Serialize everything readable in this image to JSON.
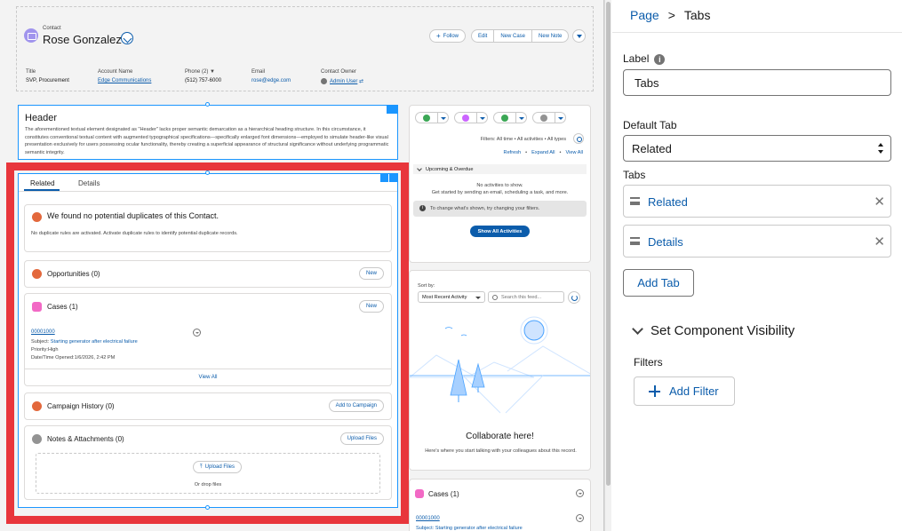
{
  "record": {
    "type": "Contact",
    "name": "Rose Gonzalez",
    "actions": {
      "follow": "Follow",
      "edit": "Edit",
      "new_case": "New Case",
      "new_note": "New Note"
    },
    "highlights": [
      {
        "label": "Title",
        "value": "SVP, Procurement"
      },
      {
        "label": "Account Name",
        "value": "Edge Communications"
      },
      {
        "label": "Phone (2)",
        "value": "(512) 757-6000"
      },
      {
        "label": "Email",
        "value": "rose@edge.com"
      },
      {
        "label": "Contact Owner",
        "value": "Admin User"
      }
    ]
  },
  "header_component": {
    "title": "Header",
    "description": "The aforementioned textual element designated as \"Header\" lacks proper semantic demarcation as a hierarchical heading structure. In this circumstance, it constitutes conventional textual content with augmented typographical specifications—specifically enlarged font dimensions—employed to simulate header-like visual presentation exclusively for users possessing ocular functionality, thereby creating a superficial appearance of structural significance without underlying programmatic semantic integrity."
  },
  "tabs_component": {
    "tabs": [
      "Related",
      "Details"
    ],
    "duplicates": {
      "title": "We found no potential duplicates of this Contact.",
      "text": "No duplicate rules are activated. Activate duplicate rules to identify potential duplicate records."
    },
    "opportunities": {
      "title": "Opportunities (0)",
      "button": "New"
    },
    "cases": {
      "title": "Cases (1)",
      "button": "New",
      "case_number": "00001000",
      "subject_label": "Subject:",
      "subject_value": "Starting generator after electrical failure",
      "priority": "Priority:High",
      "opened": "Date/Time Opened:1/6/2026, 2:42 PM",
      "view_all": "View All"
    },
    "campaign": {
      "title": "Campaign History (0)",
      "button": "Add to Campaign"
    },
    "notes": {
      "title": "Notes & Attachments (0)",
      "button": "Upload Files",
      "upload": "Upload Files",
      "drop": "Or drop files"
    }
  },
  "activity": {
    "filters": "Filters: All time • All activities • All types",
    "links": [
      "Refresh",
      "Expand All",
      "View All"
    ],
    "upcoming": "Upcoming & Overdue",
    "no_activities": "No activities to show.",
    "get_started": "Get started by sending an email, scheduling a task, and more.",
    "info": "To change what's shown, try changing your filters.",
    "show_all": "Show All Activities"
  },
  "chatter": {
    "sort_label": "Sort by:",
    "sort_value": "Most Recent Activity",
    "search_placeholder": "Search this feed...",
    "title": "Collaborate here!",
    "text": "Here's where you start talking with your colleagues about this record."
  },
  "cases_mini": {
    "title": "Cases (1)",
    "case_number": "00001000",
    "subject": "Subject: Starting generator after electrical failure"
  },
  "properties": {
    "breadcrumb": [
      "Page",
      "Tabs"
    ],
    "label_field": {
      "label": "Label",
      "value": "Tabs"
    },
    "default_tab": {
      "label": "Default Tab",
      "value": "Related"
    },
    "tabs_label": "Tabs",
    "tabs": [
      "Related",
      "Details"
    ],
    "add_tab": "Add Tab",
    "visibility": "Set Component Visibility",
    "filters_label": "Filters",
    "add_filter": "Add Filter"
  },
  "colors": {
    "accent": "#0b5cab",
    "selection": "#1b96ff",
    "highlight_frame": "#e8363c"
  }
}
